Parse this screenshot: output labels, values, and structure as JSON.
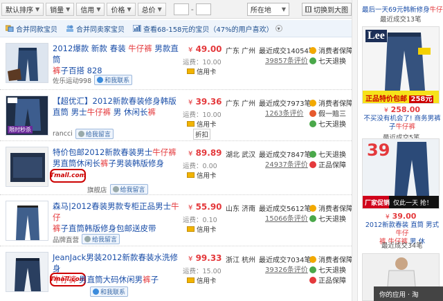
{
  "toolbar": {
    "sort_default": "默认排序",
    "sort_sales": "销量",
    "sort_credit": "信用",
    "sort_price": "价格",
    "sort_total": "总价",
    "price_dash": "-",
    "location_select": "所在地",
    "bigview_label": "切换到大图"
  },
  "filters": [
    {
      "label": "合并同款宝贝"
    },
    {
      "label": "合并同卖家宝贝"
    },
    {
      "label": "查看68-158元的宝贝（47%的用户喜欢）"
    }
  ],
  "products": [
    {
      "title_pre": "2012爆款 新款 春装 ",
      "title_hl": "牛仔裤",
      "title_post": " 男款直筒",
      "title2_hl": "裤",
      "title2_post": "子百搭 828",
      "seller": "佐乐运动998",
      "chat": "和我联系",
      "price": "49.00",
      "shipping": "运费：10.00",
      "card": "信用卡",
      "location": "广东 广州",
      "sales": "最近成交14054笔",
      "reviews": "39857条评价",
      "svc1": "消费者保障",
      "svc2": "七天退换",
      "thumb_tag": "",
      "tmall": false
    },
    {
      "title_pre": "【超优汇】2012新款春装修身韩版 直筒 男士",
      "title_hl": "牛仔裤",
      "title_post": " 男 休闲长",
      "title2_hl": "裤",
      "title2_post": "",
      "seller": "rancci",
      "chat": "给我留言",
      "price": "39.36",
      "shipping": "运费：10.00",
      "card": "信用卡",
      "discount": "折扣",
      "location": "广东 广州",
      "sales": "最近成交7973笔",
      "reviews": "1263条评价",
      "svc1": "消费者保障",
      "svc2": "假一赔三",
      "svc3": "七天退换",
      "thumb_tag": "限时秒杀",
      "tmall": false
    },
    {
      "title_pre": "特价包邮2012新款春装男士",
      "title_hl": "牛仔裤",
      "title_post": " 男直筒休闲长",
      "title2_hl": "裤",
      "title2_post": "子男装韩版修身",
      "seller": "旗舰店",
      "chat": "给我留言",
      "price": "89.89",
      "shipping": "运费：0.00",
      "card": "信用卡",
      "location": "湖北 武汉",
      "sales": "最近成交7847笔",
      "reviews": "24937条评价",
      "svc1": "七天退换",
      "svc2": "正品保障",
      "tmall": true,
      "tmall_label": "Tmall.com"
    },
    {
      "title_pre": "森马|2012春装男款专柜正品男士",
      "title_hl": "牛仔",
      "title_post": "",
      "title2_hl": "裤",
      "title2_post": "子直筒韩版修身包邮送皮带",
      "seller": "品牌直营",
      "chat": "给我留言",
      "price": "55.90",
      "shipping": "运费：0.10",
      "card": "信用卡",
      "location": "山东 济南",
      "sales": "最近成交5612笔",
      "reviews": "15066条评价",
      "svc1": "消费者保障",
      "svc2": "七天退换",
      "tmall": false
    },
    {
      "title_pre": "JeanJack男装2012新款春装水洗修身",
      "title_hl": "牛仔裤",
      "title_post": " 男直筒大码休闲男",
      "title2_hl": "裤",
      "title2_post": "子",
      "seller": "",
      "chat": "和我联系",
      "price": "99.33",
      "shipping": "运费：15.00",
      "card": "信用卡",
      "location": "浙江 杭州",
      "sales": "最近成交7034笔",
      "reviews": "39326条评价",
      "svc1": "消费者保障",
      "svc2": "七天退换",
      "svc3": "正品保障",
      "tmall": true,
      "tmall_label": "Tmall.com"
    }
  ],
  "sidebar": {
    "top_link_pre": "最后一天69元韩新修身",
    "top_link_hl": "牛仔裤",
    "top_sales": "最近成交13笔",
    "ad1_brand": "Lee",
    "ad1_banner": "正品特价包邮",
    "ad1_banner_price": "258元",
    "ad1_price": "258.00",
    "ad1_link_pre": "不买没有机会了! 商务男裤子",
    "ad1_link_hl": "牛仔裤",
    "ad1_sales": "最近成交5笔",
    "ad2_num": "39",
    "ad2_banner_l": "厂家促销",
    "ad2_banner_r": "仅此一天 抢！",
    "ad2_price": "39.00",
    "ad2_link_pre": "2012新款春装 直筒 男式",
    "ad2_link_hl": "牛仔",
    "ad2_link_mid": "裤",
    "ad2_link_hl2": " 牛仔裤",
    "ad2_link_post": "男 休",
    "ad2_sales": "最近成交34笔",
    "bottom_bar": "你的应用 · 淘"
  },
  "colors": {
    "link": "#1a4ea8",
    "highlight": "#e4393c",
    "tmall": "#cc0000"
  }
}
